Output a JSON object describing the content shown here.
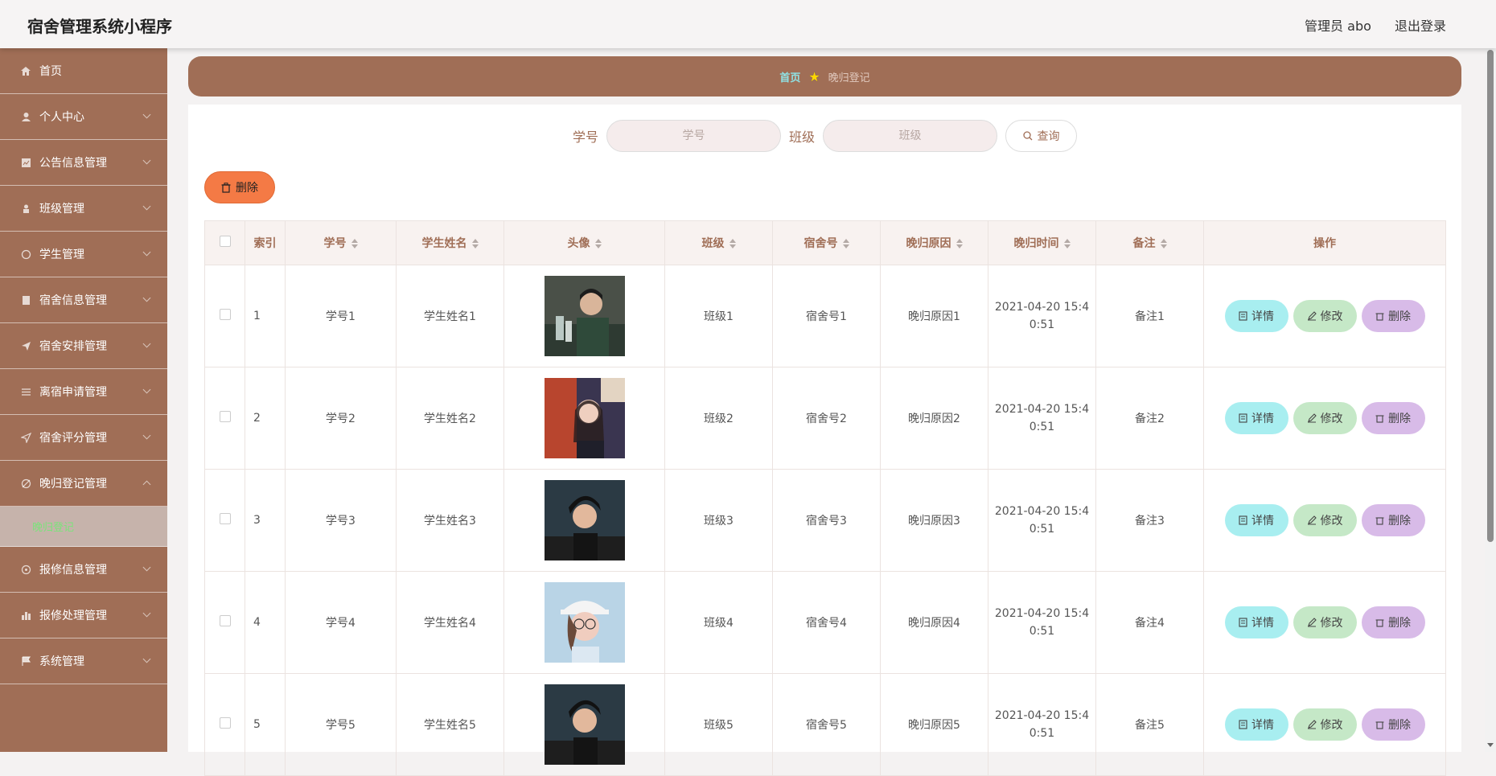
{
  "app": {
    "title": "宿舍管理系统小程序",
    "user": "管理员 abo",
    "logout": "退出登录"
  },
  "sidebar": {
    "items": [
      {
        "label": "首页",
        "icon": "home-icon",
        "chevron": false
      },
      {
        "label": "个人中心",
        "icon": "user-icon",
        "chevron": true
      },
      {
        "label": "公告信息管理",
        "icon": "notice-icon",
        "chevron": true
      },
      {
        "label": "班级管理",
        "icon": "class-icon",
        "chevron": true
      },
      {
        "label": "学生管理",
        "icon": "student-icon",
        "chevron": true
      },
      {
        "label": "宿舍信息管理",
        "icon": "dorm-icon",
        "chevron": true
      },
      {
        "label": "宿舍安排管理",
        "icon": "send-icon",
        "chevron": true
      },
      {
        "label": "离宿申请管理",
        "icon": "sliders-icon",
        "chevron": true
      },
      {
        "label": "宿舍评分管理",
        "icon": "nav-icon",
        "chevron": true
      },
      {
        "label": "晚归登记管理",
        "icon": "clock-icon",
        "chevron": true,
        "expanded": true
      }
    ],
    "sub_item": "晚归登记",
    "items_after": [
      {
        "label": "报修信息管理",
        "icon": "repair-icon",
        "chevron": true
      },
      {
        "label": "报修处理管理",
        "icon": "chart-icon",
        "chevron": true
      },
      {
        "label": "系统管理",
        "icon": "flag-icon",
        "chevron": true
      }
    ]
  },
  "breadcrumb": {
    "home": "首页",
    "current": "晚归登记"
  },
  "search": {
    "label1": "学号",
    "placeholder1": "学号",
    "label2": "班级",
    "placeholder2": "班级",
    "button": "查询"
  },
  "actions": {
    "delete": "删除"
  },
  "table": {
    "headers": [
      "索引",
      "学号",
      "学生姓名",
      "头像",
      "班级",
      "宿舍号",
      "晚归原因",
      "晚归时间",
      "备注",
      "操作"
    ],
    "rows": [
      {
        "idx": "1",
        "xuehao": "学号1",
        "name": "学生姓名1",
        "class": "班级1",
        "dorm": "宿舍号1",
        "reason": "晚归原因1",
        "time1": "2021-04-20 15:4",
        "time2": "0:51",
        "note": "备注1"
      },
      {
        "idx": "2",
        "xuehao": "学号2",
        "name": "学生姓名2",
        "class": "班级2",
        "dorm": "宿舍号2",
        "reason": "晚归原因2",
        "time1": "2021-04-20 15:4",
        "time2": "0:51",
        "note": "备注2"
      },
      {
        "idx": "3",
        "xuehao": "学号3",
        "name": "学生姓名3",
        "class": "班级3",
        "dorm": "宿舍号3",
        "reason": "晚归原因3",
        "time1": "2021-04-20 15:4",
        "time2": "0:51",
        "note": "备注3"
      },
      {
        "idx": "4",
        "xuehao": "学号4",
        "name": "学生姓名4",
        "class": "班级4",
        "dorm": "宿舍号4",
        "reason": "晚归原因4",
        "time1": "2021-04-20 15:4",
        "time2": "0:51",
        "note": "备注4"
      },
      {
        "idx": "5",
        "xuehao": "学号5",
        "name": "学生姓名5",
        "class": "班级5",
        "dorm": "宿舍号5",
        "reason": "晚归原因5",
        "time1": "2021-04-20 15:4",
        "time2": "0:51",
        "note": "备注5"
      }
    ],
    "op_detail": "详情",
    "op_edit": "修改",
    "op_delete": "删除"
  },
  "colors": {
    "brand": "#a06e56",
    "delete": "#f47a45",
    "detail": "#a8eef0",
    "edit": "#c5e8c7",
    "del_row": "#d8bbe8"
  }
}
